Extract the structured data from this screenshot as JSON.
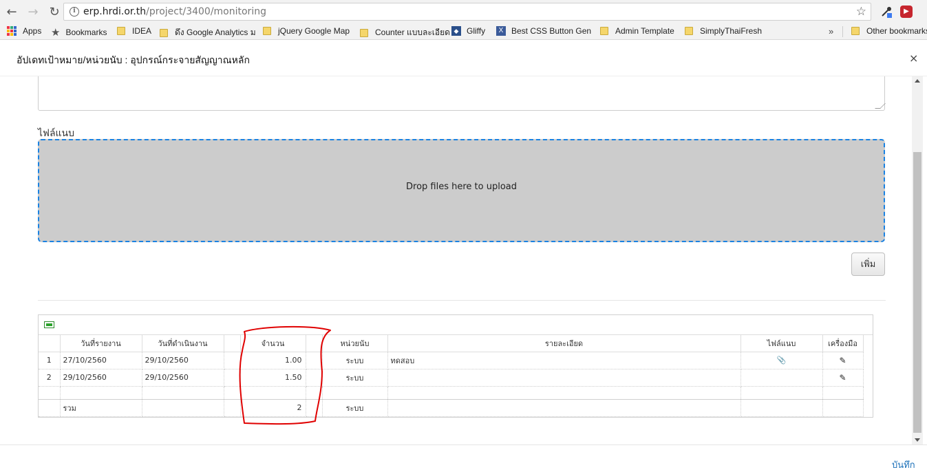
{
  "browser": {
    "url_host": "erp.hrdi.or.th",
    "url_path": "/project/3400/monitoring",
    "bookmarks": [
      {
        "label": "Apps",
        "icon": "apps-grid-icon"
      },
      {
        "label": "Bookmarks",
        "icon": "star-icon"
      },
      {
        "label": "IDEA",
        "icon": "folder-icon"
      },
      {
        "label": "ดึง Google Analytics ม",
        "icon": "folder-icon"
      },
      {
        "label": "jQuery Google Map",
        "icon": "folder-icon"
      },
      {
        "label": "Counter แบบละเอียด",
        "icon": "folder-icon"
      },
      {
        "label": "Gliffy",
        "icon": "gliffy-icon"
      },
      {
        "label": "Best CSS Button Gen",
        "icon": "x-icon"
      },
      {
        "label": "Admin Template",
        "icon": "folder-icon"
      },
      {
        "label": "SimplyThaiFresh",
        "icon": "folder-icon"
      }
    ],
    "overflow": "»",
    "other_bookmarks": "Other bookmarks"
  },
  "modal": {
    "title": "อัปเดทเป้าหมาย/หน่วยนับ : อุปกรณ์กระจายสัญญาณหลัก",
    "close": "×",
    "file_label": "ไฟล์แนบ",
    "dropzone_text": "Drop files here to upload",
    "add_button": "เพิ่ม",
    "save": "บันทึก"
  },
  "table": {
    "columns": [
      "",
      "วันที่รายงาน",
      "วันที่ดำเนินงาน",
      "",
      "จำนวน",
      "",
      "หน่วยนับ",
      "รายละเอียด",
      "ไฟล์แนบ",
      "เครื่องมือ"
    ],
    "rows": [
      {
        "no": "1",
        "report_date": "27/10/2560",
        "work_date": "29/10/2560",
        "qty": "1.00",
        "unit": "ระบบ",
        "detail": "ทดสอบ"
      },
      {
        "no": "2",
        "report_date": "29/10/2560",
        "work_date": "29/10/2560",
        "qty": "1.50",
        "unit": "ระบบ",
        "detail": ""
      }
    ],
    "total": {
      "label": "รวม",
      "qty": "2",
      "unit": "ระบบ"
    }
  },
  "colors": {
    "dropzone_border": "#1a82e2",
    "dropzone_bg": "#cccccc",
    "link": "#1a6fb8",
    "annotation": "#e00000"
  }
}
